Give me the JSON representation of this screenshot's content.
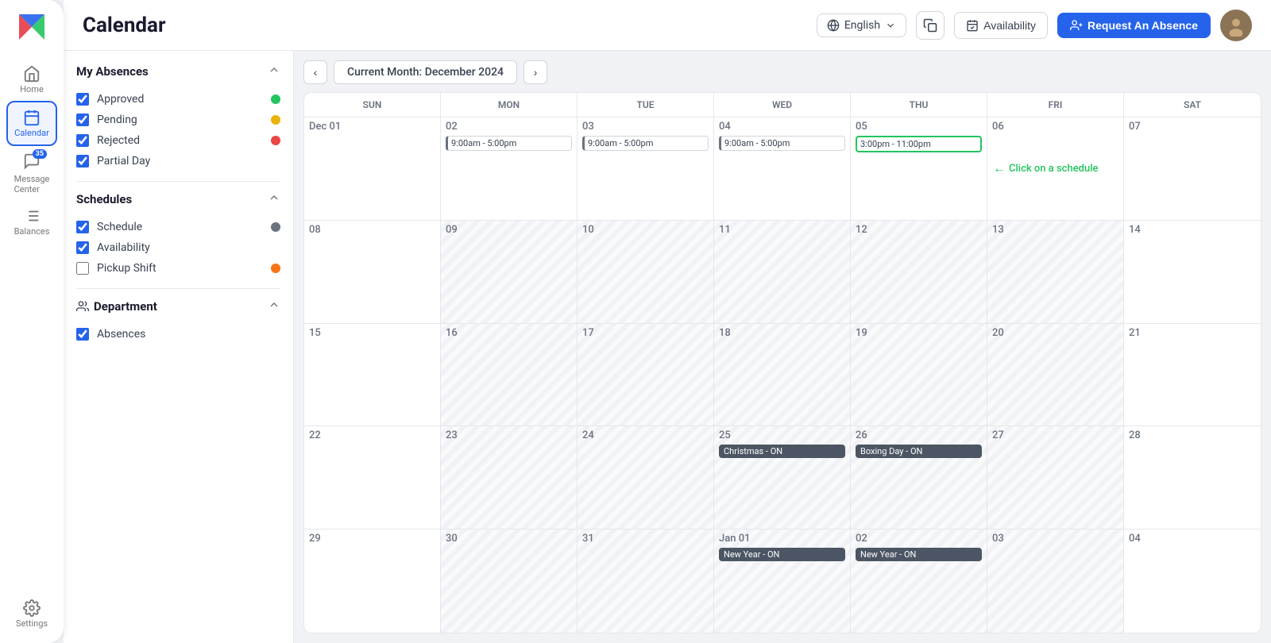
{
  "app": {
    "logo_alt": "Company Logo"
  },
  "sidebar": {
    "items": [
      {
        "id": "home",
        "label": "Home",
        "active": false
      },
      {
        "id": "calendar",
        "label": "Calendar",
        "active": true
      },
      {
        "id": "messages",
        "label": "Message Center",
        "active": false,
        "badge": "35"
      },
      {
        "id": "balances",
        "label": "Balances",
        "active": false
      },
      {
        "id": "settings",
        "label": "Settings",
        "active": false
      }
    ]
  },
  "header": {
    "title": "Calendar",
    "language": "English",
    "actions": {
      "copy_label": "Copy",
      "availability_label": "Availability",
      "request_label": "Request An Absence"
    }
  },
  "calendar": {
    "current_month_label": "Current Month: December 2024",
    "day_headers": [
      "SUN",
      "MON",
      "TUE",
      "WED",
      "THU",
      "FRI",
      "SAT"
    ],
    "weeks": [
      [
        {
          "date": "Dec 01",
          "number": "01",
          "other": false,
          "events": [],
          "holiday": null
        },
        {
          "date": "Dec 02",
          "number": "02",
          "other": false,
          "events": [
            "9:00am - 5:00pm"
          ],
          "holiday": null
        },
        {
          "date": "Dec 03",
          "number": "03",
          "other": false,
          "events": [
            "9:00am - 5:00pm"
          ],
          "holiday": null
        },
        {
          "date": "Dec 04",
          "number": "04",
          "other": false,
          "events": [
            "9:00am - 5:00pm"
          ],
          "holiday": null
        },
        {
          "date": "Dec 05",
          "number": "05",
          "other": false,
          "events": [
            "3:00pm - 11:00pm"
          ],
          "highlighted": true,
          "holiday": null
        },
        {
          "date": "Dec 06",
          "number": "06",
          "other": false,
          "events": [],
          "holiday": null
        },
        {
          "date": "Dec 07",
          "number": "07",
          "other": false,
          "events": [],
          "holiday": null
        }
      ],
      [
        {
          "date": "Dec 08",
          "number": "08",
          "other": false,
          "events": [],
          "holiday": null
        },
        {
          "date": "Dec 09",
          "number": "09",
          "other": true,
          "events": [],
          "holiday": null
        },
        {
          "date": "Dec 10",
          "number": "10",
          "other": true,
          "events": [],
          "holiday": null
        },
        {
          "date": "Dec 11",
          "number": "11",
          "other": true,
          "events": [],
          "holiday": null
        },
        {
          "date": "Dec 12",
          "number": "12",
          "other": true,
          "events": [],
          "holiday": null
        },
        {
          "date": "Dec 13",
          "number": "13",
          "other": true,
          "events": [],
          "holiday": null
        },
        {
          "date": "Dec 14",
          "number": "14",
          "other": false,
          "events": [],
          "holiday": null
        }
      ],
      [
        {
          "date": "Dec 15",
          "number": "15",
          "other": false,
          "events": [],
          "holiday": null
        },
        {
          "date": "Dec 16",
          "number": "16",
          "other": true,
          "events": [],
          "holiday": null
        },
        {
          "date": "Dec 17",
          "number": "17",
          "other": true,
          "events": [],
          "holiday": null
        },
        {
          "date": "Dec 18",
          "number": "18",
          "other": true,
          "events": [],
          "holiday": null
        },
        {
          "date": "Dec 19",
          "number": "19",
          "other": true,
          "events": [],
          "holiday": null
        },
        {
          "date": "Dec 20",
          "number": "20",
          "other": true,
          "events": [],
          "holiday": null
        },
        {
          "date": "Dec 21",
          "number": "21",
          "other": false,
          "events": [],
          "holiday": null
        }
      ],
      [
        {
          "date": "Dec 22",
          "number": "22",
          "other": false,
          "events": [],
          "holiday": null
        },
        {
          "date": "Dec 23",
          "number": "23",
          "other": true,
          "events": [],
          "holiday": null
        },
        {
          "date": "Dec 24",
          "number": "24",
          "other": true,
          "events": [],
          "holiday": null
        },
        {
          "date": "Dec 25",
          "number": "25",
          "other": true,
          "events": [],
          "holiday": "Christmas - ON"
        },
        {
          "date": "Dec 26",
          "number": "26",
          "other": true,
          "events": [],
          "holiday": "Boxing Day - ON"
        },
        {
          "date": "Dec 27",
          "number": "27",
          "other": true,
          "events": [],
          "holiday": null
        },
        {
          "date": "Dec 28",
          "number": "28",
          "other": false,
          "events": [],
          "holiday": null
        }
      ],
      [
        {
          "date": "Dec 29",
          "number": "29",
          "other": false,
          "events": [],
          "holiday": null
        },
        {
          "date": "Dec 30",
          "number": "30",
          "other": true,
          "events": [],
          "holiday": null
        },
        {
          "date": "Dec 31",
          "number": "31",
          "other": true,
          "events": [],
          "holiday": null
        },
        {
          "date": "Jan 01",
          "number": "Jan 01",
          "other": true,
          "events": [],
          "holiday": "New Year - ON"
        },
        {
          "date": "Jan 02",
          "number": "02",
          "other": true,
          "events": [],
          "holiday": "New Year - ON"
        },
        {
          "date": "Jan 03",
          "number": "03",
          "other": true,
          "events": [],
          "holiday": null
        },
        {
          "date": "Jan 04",
          "number": "04",
          "other": false,
          "events": [],
          "holiday": null
        }
      ]
    ],
    "click_hint": "Click on a schedule"
  },
  "filters": {
    "my_absences": {
      "title": "My Absences",
      "items": [
        {
          "id": "approved",
          "label": "Approved",
          "checked": true,
          "dot": "green"
        },
        {
          "id": "pending",
          "label": "Pending",
          "checked": true,
          "dot": "yellow"
        },
        {
          "id": "rejected",
          "label": "Rejected",
          "checked": true,
          "dot": "red"
        },
        {
          "id": "partial_day",
          "label": "Partial Day",
          "checked": true,
          "dot": null
        }
      ]
    },
    "schedules": {
      "title": "Schedules",
      "items": [
        {
          "id": "schedule",
          "label": "Schedule",
          "checked": true,
          "dot": "blue"
        },
        {
          "id": "availability",
          "label": "Availability",
          "checked": true,
          "dot": null
        },
        {
          "id": "pickup_shift",
          "label": "Pickup Shift",
          "checked": false,
          "dot": "orange"
        }
      ]
    },
    "department": {
      "title": "Department",
      "items": [
        {
          "id": "absences",
          "label": "Absences",
          "checked": true,
          "dot": null
        }
      ]
    }
  }
}
